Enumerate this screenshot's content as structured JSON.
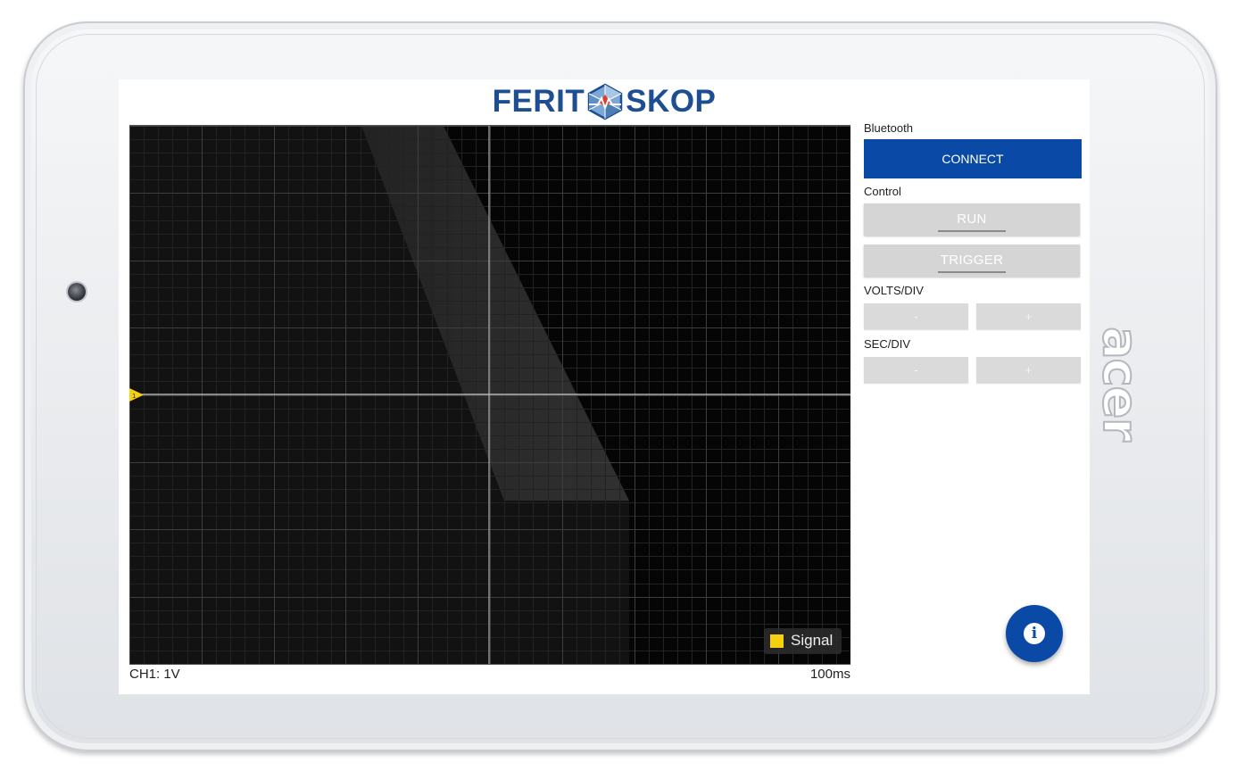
{
  "device": {
    "brand": "acer"
  },
  "app": {
    "logo_left": "FERIT",
    "logo_right": "SKOP"
  },
  "scope": {
    "channel_scale": "CH1: 1V",
    "time_scale": "100ms",
    "legend": {
      "label": "Signal",
      "color": "#f7d010"
    },
    "trigger_marker": "1",
    "trace_color": "#f7d010"
  },
  "panel": {
    "bluetooth_label": "Bluetooth",
    "connect_label": "CONNECT",
    "control_label": "Control",
    "run_label": "RUN",
    "trigger_label": "TRIGGER",
    "volts_div_label": "VOLTS/DIV",
    "volts_minus": "-",
    "volts_plus": "+",
    "sec_div_label": "SEC/DIV",
    "sec_minus": "-",
    "sec_plus": "+",
    "info_icon": "info-icon"
  },
  "colors": {
    "accent": "#0a4aa6",
    "logo": "#1d4e93"
  }
}
